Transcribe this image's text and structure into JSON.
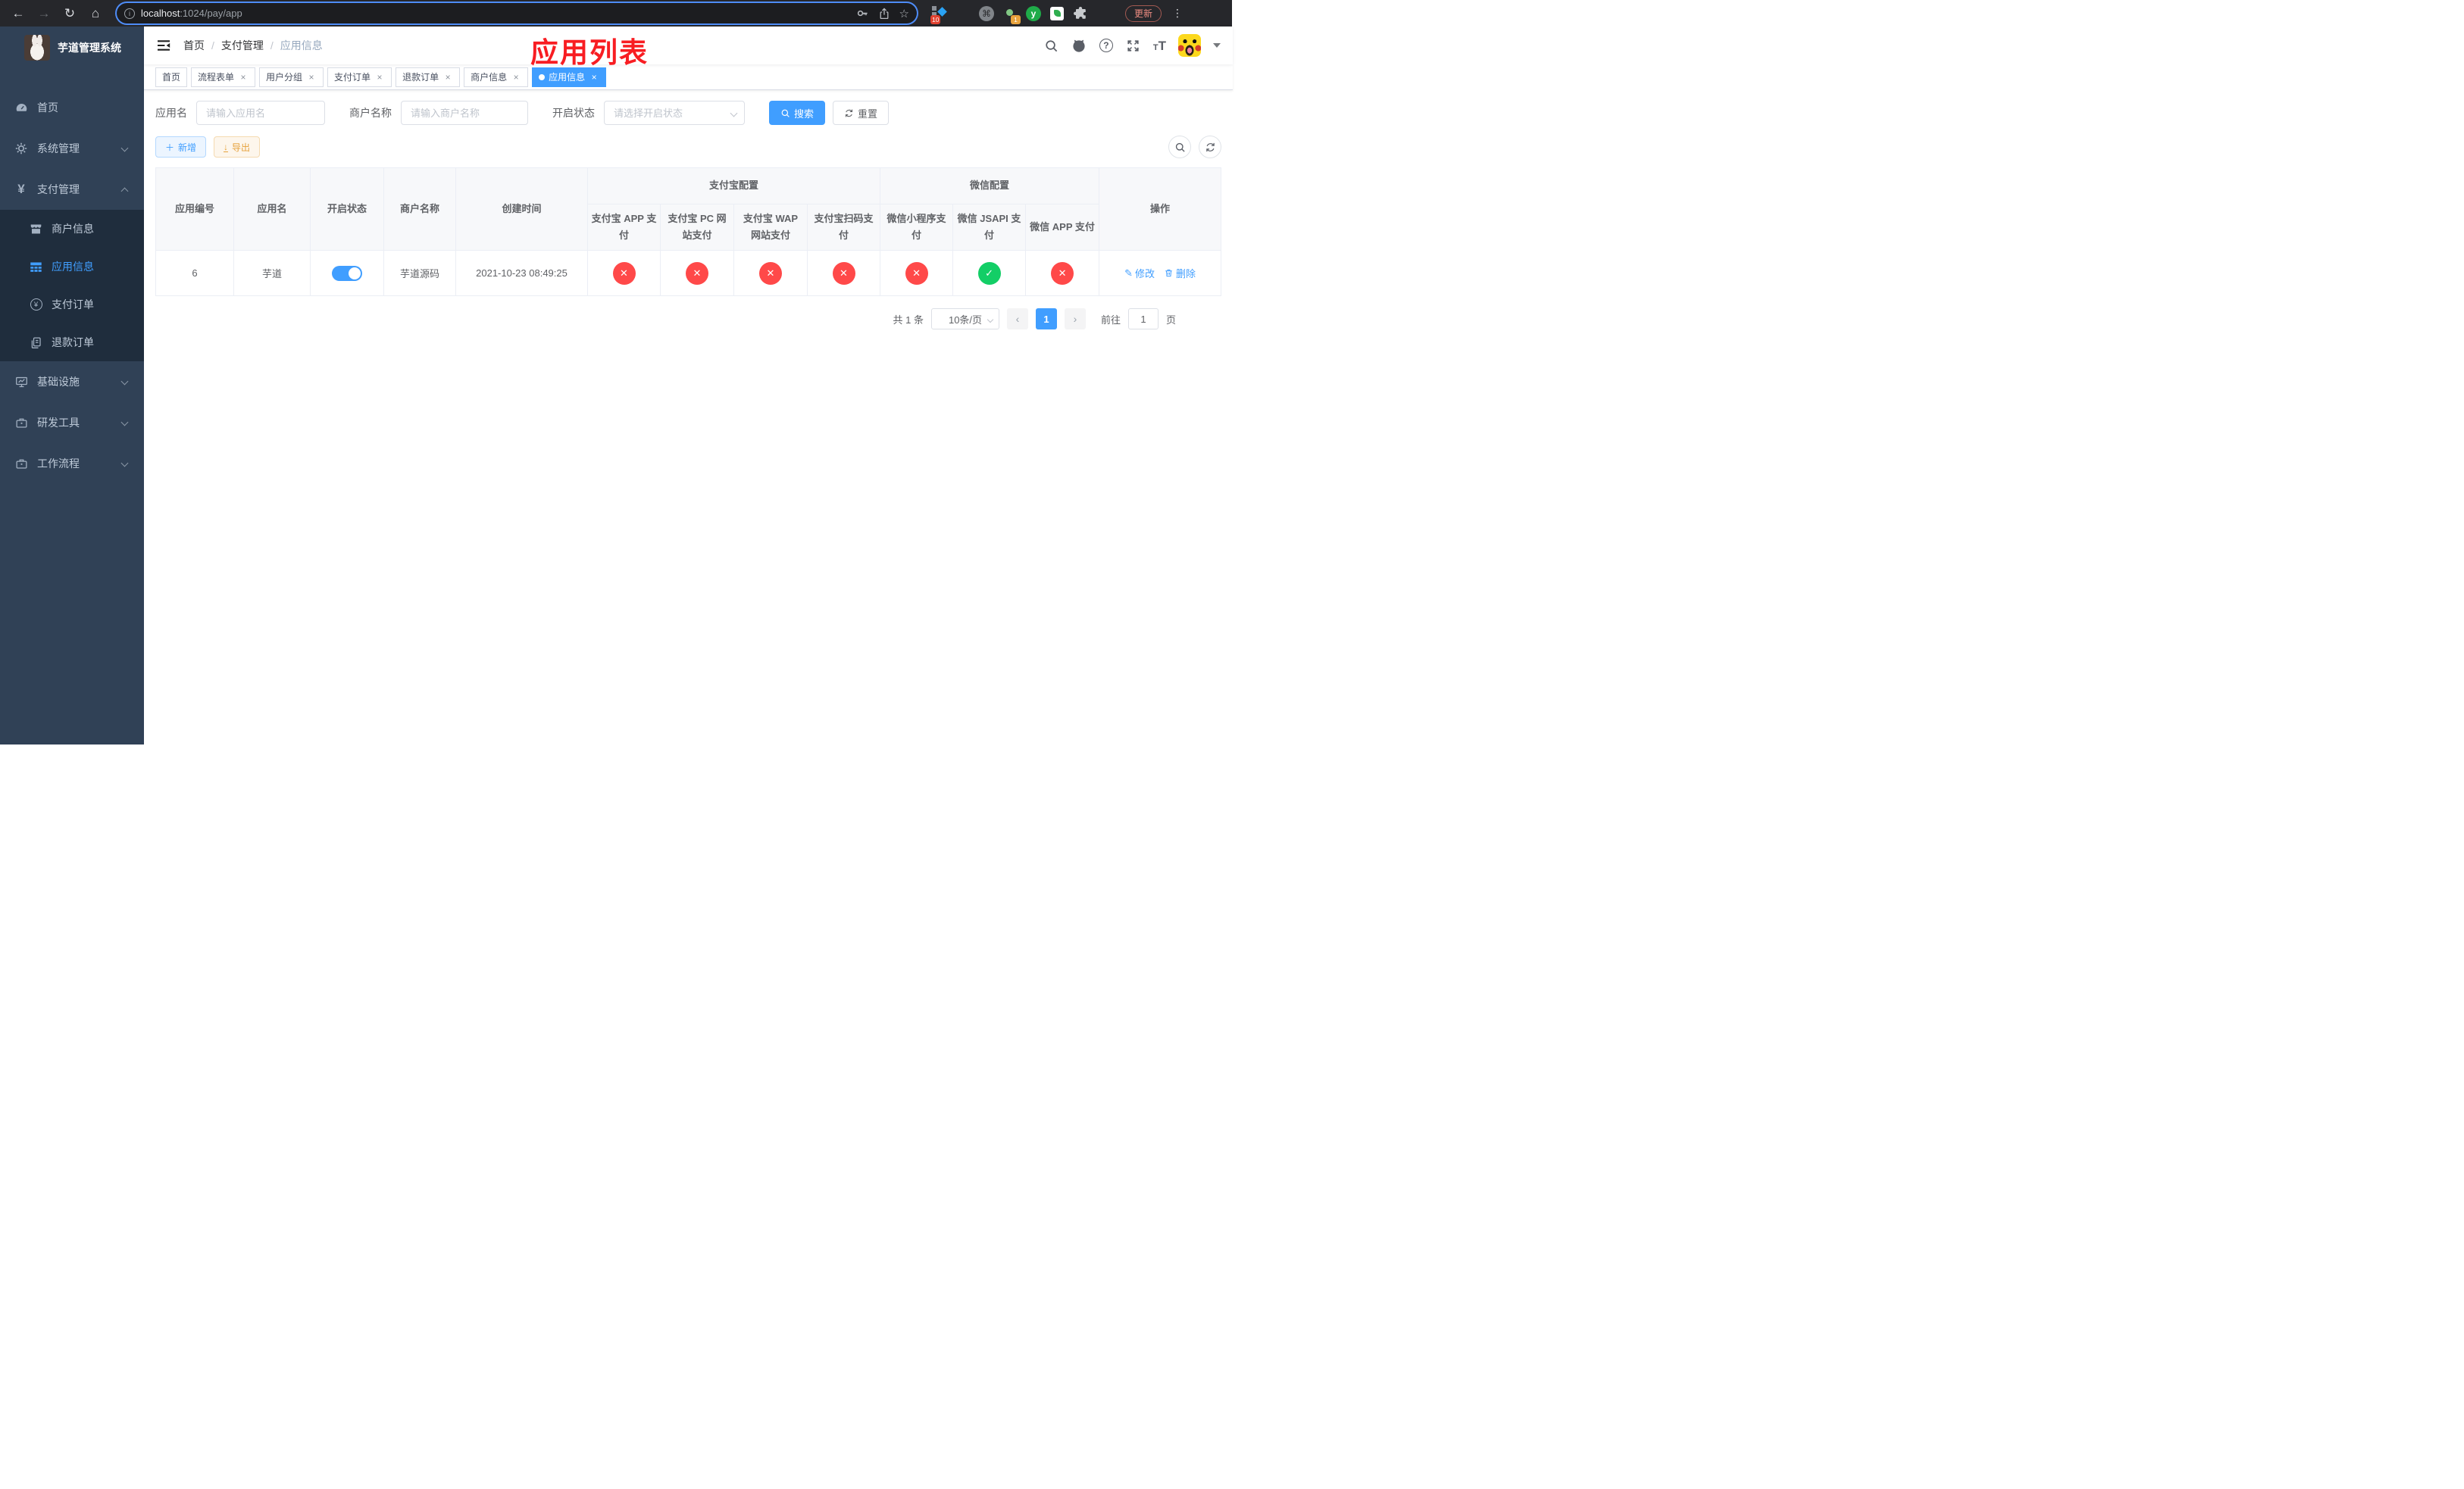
{
  "browser": {
    "url_host": "localhost",
    "url_path": ":1024/pay/app",
    "update_label": "更新",
    "ext_badge_red": "10",
    "ext_badge_orange": "1"
  },
  "sidebar": {
    "title": "芋道管理系统",
    "menu": [
      {
        "label": "首页",
        "icon": "dashboard-icon"
      },
      {
        "label": "系统管理",
        "icon": "gear-icon"
      },
      {
        "label": "支付管理",
        "icon": "yen-icon"
      },
      {
        "label": "商户信息",
        "icon": "shop-icon"
      },
      {
        "label": "应用信息",
        "icon": "grid-icon"
      },
      {
        "label": "支付订单",
        "icon": "yen-circle-icon"
      },
      {
        "label": "退款订单",
        "icon": "documents-icon"
      },
      {
        "label": "基础设施",
        "icon": "monitor-icon"
      },
      {
        "label": "研发工具",
        "icon": "toolbox-icon"
      },
      {
        "label": "工作流程",
        "icon": "briefcase-icon"
      }
    ]
  },
  "navbar": {
    "breadcrumb": [
      "首页",
      "支付管理",
      "应用信息"
    ],
    "separator": "/",
    "annotation": "应用列表",
    "annotation_color": "#f81d22"
  },
  "tags": [
    {
      "label": "首页",
      "closable": false,
      "active": false
    },
    {
      "label": "流程表单",
      "closable": true,
      "active": false
    },
    {
      "label": "用户分组",
      "closable": true,
      "active": false
    },
    {
      "label": "支付订单",
      "closable": true,
      "active": false
    },
    {
      "label": "退款订单",
      "closable": true,
      "active": false
    },
    {
      "label": "商户信息",
      "closable": true,
      "active": false
    },
    {
      "label": "应用信息",
      "closable": true,
      "active": true
    }
  ],
  "filters": {
    "app_name_label": "应用名",
    "app_name_placeholder": "请输入应用名",
    "merchant_label": "商户名称",
    "merchant_placeholder": "请输入商户名称",
    "status_label": "开启状态",
    "status_placeholder": "请选择开启状态",
    "search_label": "搜索",
    "reset_label": "重置"
  },
  "toolbar": {
    "add_label": "新增",
    "export_label": "导出"
  },
  "table": {
    "group_headers": {
      "alipay": "支付宝配置",
      "wechat": "微信配置"
    },
    "headers": [
      "应用编号",
      "应用名",
      "开启状态",
      "商户名称",
      "创建时间",
      "支付宝 APP 支付",
      "支付宝 PC 网站支付",
      "支付宝 WAP 网站支付",
      "支付宝扫码支付",
      "微信小程序支付",
      "微信 JSAPI 支付",
      "微信 APP 支付",
      "操作"
    ],
    "row": {
      "id": "6",
      "name": "芋道",
      "enabled": true,
      "merchant": "芋道源码",
      "created_at": "2021-10-23 08:49:25",
      "channels": [
        false,
        false,
        false,
        false,
        false,
        true,
        false
      ],
      "edit_label": "修改",
      "delete_label": "删除"
    },
    "status_colors": {
      "ok": "#13ce66",
      "fail": "#ff4949"
    }
  },
  "pagination": {
    "total_text": "共 1 条",
    "page_size": "10条/页",
    "current_page": "1",
    "goto_label": "前往",
    "goto_value": "1",
    "page_label": "页"
  },
  "colors": {
    "accent": "#409EFF",
    "sidebar_bg": "#304156",
    "submenu_bg": "#1f2d3d"
  }
}
